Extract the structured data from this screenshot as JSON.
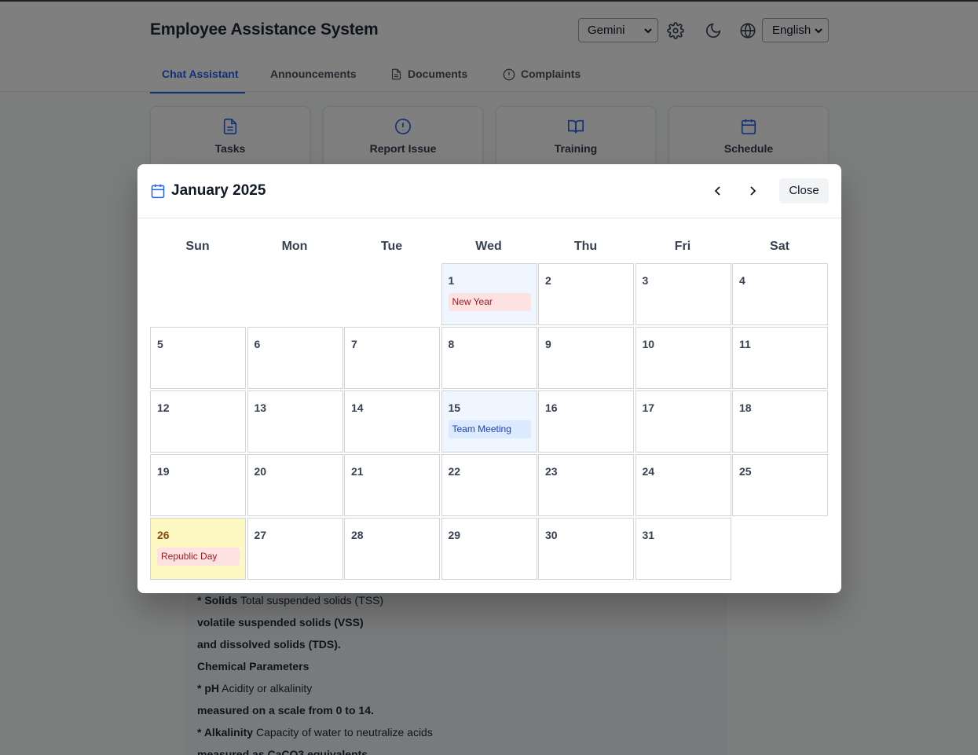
{
  "header": {
    "title": "Employee Assistance System",
    "model_select": "Gemini",
    "language_select": "English"
  },
  "tabs": [
    {
      "label": "Chat Assistant"
    },
    {
      "label": "Announcements"
    },
    {
      "label": "Documents"
    },
    {
      "label": "Complaints"
    }
  ],
  "cards": [
    {
      "label": "Tasks"
    },
    {
      "label": "Report Issue"
    },
    {
      "label": "Training"
    },
    {
      "label": "Schedule"
    }
  ],
  "chat": {
    "lines": [
      {
        "bold": "* Solids",
        "text": " Total suspended solids (TSS)"
      },
      {
        "bold": "volatile suspended solids (VSS)",
        "text": ""
      },
      {
        "bold": "and dissolved solids (TDS).",
        "text": ""
      },
      {
        "bold": "Chemical Parameters",
        "text": ""
      },
      {
        "bold": "* pH",
        "text": " Acidity or alkalinity"
      },
      {
        "bold": "measured on a scale from 0 to 14.",
        "text": ""
      },
      {
        "bold": "* Alkalinity",
        "text": " Capacity of water to neutralize acids"
      },
      {
        "bold": "measured as CaCO3 equivalents",
        "text": ""
      }
    ]
  },
  "calendar": {
    "title": "January 2025",
    "close_label": "Close",
    "weekdays": [
      "Sun",
      "Mon",
      "Tue",
      "Wed",
      "Thu",
      "Fri",
      "Sat"
    ],
    "first_weekday": 3,
    "days_in_month": 31,
    "days": [
      {
        "day": 1,
        "event": "New Year",
        "event_type": "holiday",
        "highlight": true
      },
      {
        "day": 15,
        "event": "Team Meeting",
        "event_type": "meeting",
        "highlight": true
      },
      {
        "day": 26,
        "event": "Republic Day",
        "event_type": "holiday",
        "today": true
      }
    ],
    "colors": {
      "accent": "#2563eb",
      "holiday_bg": "#fee2e2",
      "meeting_bg": "#dbeafe",
      "today_bg": "#fef9c3"
    }
  }
}
